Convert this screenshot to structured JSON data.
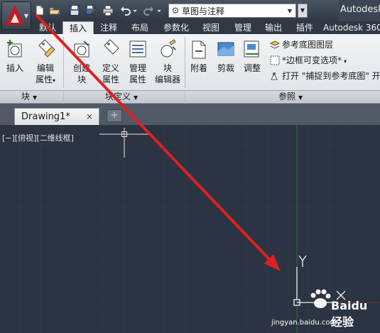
{
  "quick_access": {
    "workspace": "草图与注释",
    "app_title": "Autodesk 360"
  },
  "tabs": [
    {
      "label": "默认"
    },
    {
      "label": "插入"
    },
    {
      "label": "注释"
    },
    {
      "label": "布局"
    },
    {
      "label": "参数化"
    },
    {
      "label": "视图"
    },
    {
      "label": "管理"
    },
    {
      "label": "输出"
    },
    {
      "label": "插件"
    },
    {
      "label": "Autodesk 360"
    }
  ],
  "ribbon": {
    "insert_label": "插入",
    "edit_attr_1": "编辑",
    "edit_attr_2": "属性",
    "create_block_1": "创建",
    "create_block_2": "块",
    "define_attr_1": "定义",
    "define_attr_2": "属性",
    "manage_attr_1": "管理",
    "manage_attr_2": "属性",
    "block_editor_1": "块",
    "block_editor_2": "编辑器",
    "attach": "附着",
    "clip": "剪裁",
    "adjust": "调整",
    "underlay_layers": "参考底图图层",
    "frames_vary": "*边框可变选项*",
    "snap_underlay": "打开 \"捕捉到参考底图\" 开"
  },
  "panels": {
    "block": "块",
    "block_def": "块定义",
    "reference": "参照"
  },
  "doc_tab": {
    "name": "Drawing1*",
    "close": "×",
    "new": "+"
  },
  "viewport": {
    "label": "[−][俯视][二维线框]",
    "y_axis": "Y",
    "x_axis": "X"
  },
  "watermark": {
    "brand": "Baidu 经验",
    "url": "jingyan.baidu.com"
  },
  "colors": {
    "canvas": "#2b3442",
    "grid": "#364052",
    "arrow": "#e02020",
    "accent": "#c8161d"
  }
}
